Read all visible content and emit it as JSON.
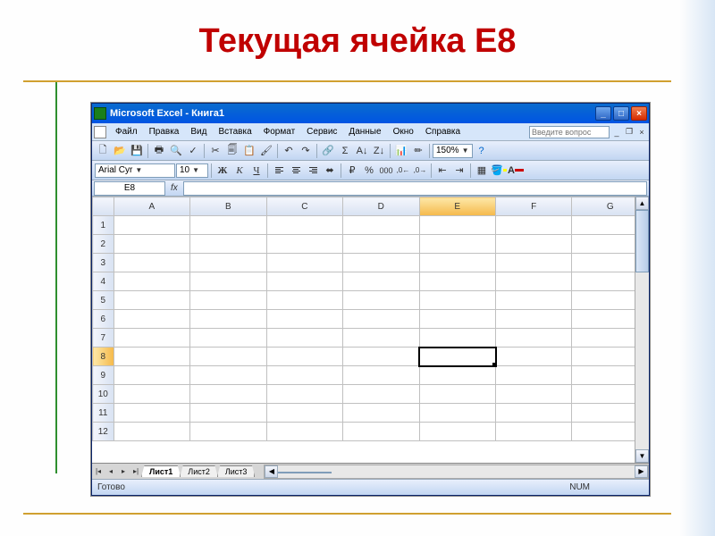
{
  "slide": {
    "title": "Текущая ячейка E8"
  },
  "titlebar": {
    "text": "Microsoft Excel - Книга1"
  },
  "window_controls": {
    "minimize": "_",
    "maximize": "□",
    "close": "×"
  },
  "menu": {
    "items": [
      "Файл",
      "Правка",
      "Вид",
      "Вставка",
      "Формат",
      "Сервис",
      "Данные",
      "Окно",
      "Справка"
    ],
    "help_placeholder": "Введите вопрос"
  },
  "mdi": {
    "min": "_",
    "restore": "❐",
    "close": "×"
  },
  "toolbar": {
    "zoom": "150%"
  },
  "format": {
    "font_name": "Arial Cyr",
    "font_size": "10",
    "bold": "Ж",
    "italic": "К",
    "underline": "Ч"
  },
  "namebox": {
    "value": "E8",
    "fx": "fx"
  },
  "grid": {
    "columns": [
      "A",
      "B",
      "C",
      "D",
      "E",
      "F",
      "G"
    ],
    "rows": [
      "1",
      "2",
      "3",
      "4",
      "5",
      "6",
      "7",
      "8",
      "9",
      "10",
      "11",
      "12"
    ],
    "selected_col": "E",
    "selected_row": "8"
  },
  "tabs": {
    "nav": {
      "first": "|◂",
      "prev": "◂",
      "next": "▸",
      "last": "▸|"
    },
    "sheets": [
      "Лист1",
      "Лист2",
      "Лист3"
    ],
    "active": "Лист1"
  },
  "status": {
    "ready": "Готово",
    "num": "NUM"
  }
}
